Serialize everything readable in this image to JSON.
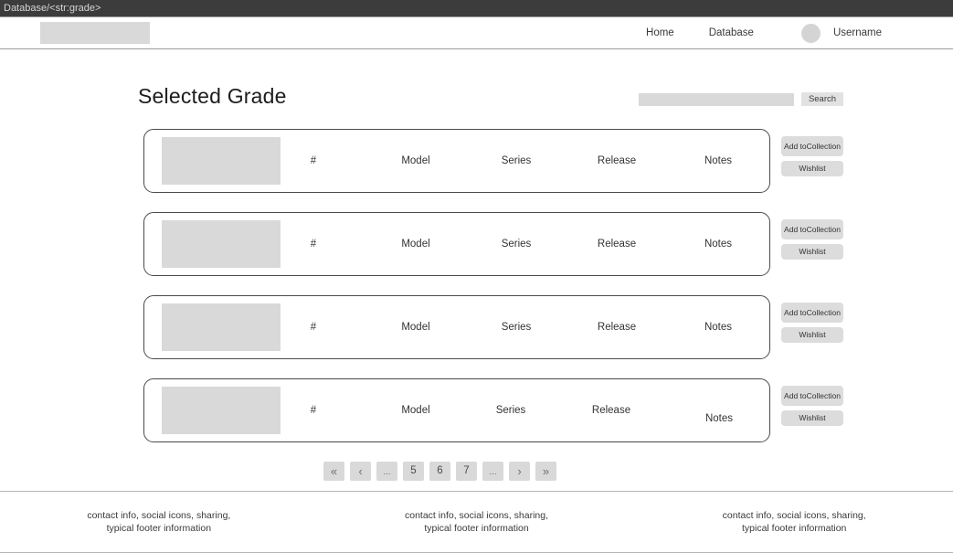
{
  "window": {
    "title": "Database/<str:grade>"
  },
  "nav": {
    "logo_alt": "logo-placeholder",
    "links": [
      {
        "label": "Home"
      },
      {
        "label": "Database"
      }
    ],
    "username": "Username"
  },
  "page": {
    "title": "Selected Grade"
  },
  "search": {
    "value": "",
    "placeholder": "",
    "button_label": "Search"
  },
  "cards": [
    {
      "number": "#",
      "model": "Model",
      "series": "Series",
      "release": "Release",
      "notes": "Notes",
      "add_label_line1": "Add to",
      "add_label_line2": "Collection",
      "wishlist_label": "Wishlist"
    },
    {
      "number": "#",
      "model": "Model",
      "series": "Series",
      "release": "Release",
      "notes": "Notes",
      "add_label_line1": "Add to",
      "add_label_line2": "Collection",
      "wishlist_label": "Wishlist"
    },
    {
      "number": "#",
      "model": "Model",
      "series": "Series",
      "release": "Release",
      "notes": "Notes",
      "add_label_line1": "Add to",
      "add_label_line2": "Collection",
      "wishlist_label": "Wishlist"
    },
    {
      "number": "#",
      "model": "Model",
      "series": "Series",
      "release": "Release",
      "notes": "Notes",
      "add_label_line1": "Add to",
      "add_label_line2": "Collection",
      "wishlist_label": "Wishlist"
    }
  ],
  "pagination": {
    "first_label": "«",
    "prev_label": "‹",
    "ellipsis_left": "...",
    "pages": [
      "5",
      "6",
      "7"
    ],
    "ellipsis_right": "...",
    "next_label": "›",
    "last_label": "»"
  },
  "footer": {
    "columns": [
      {
        "line1": "contact info, social icons, sharing,",
        "line2": "typical footer information"
      },
      {
        "line1": "contact info, social icons, sharing,",
        "line2": "typical footer information"
      },
      {
        "line1": "contact info, social icons, sharing,",
        "line2": "typical footer information"
      }
    ]
  },
  "colors": {
    "titlebar_bg": "#3c3c3c",
    "placeholder_gray": "#d9d9d9",
    "button_gray": "#dcdcdc",
    "card_border": "#4a4a4a"
  }
}
